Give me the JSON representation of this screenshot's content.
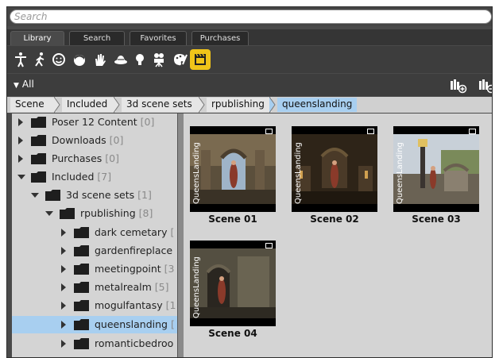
{
  "search": {
    "placeholder": "Search"
  },
  "tabs": [
    {
      "label": "Library",
      "active": true
    },
    {
      "label": "Search",
      "active": false
    },
    {
      "label": "Favorites",
      "active": false
    },
    {
      "label": "Purchases",
      "active": false
    }
  ],
  "toolbar_icons": [
    "figure-icon",
    "pose-icon",
    "expression-icon",
    "hair-icon",
    "hand-icon",
    "props-icon",
    "light-icon",
    "camera-icon",
    "materials-icon",
    "scene-icon"
  ],
  "filter": {
    "label": "All"
  },
  "breadcrumb": [
    "Scene",
    "Included",
    "3d scene sets",
    "rpublishing",
    "queenslanding"
  ],
  "tree": [
    {
      "label": "Poser 12 Content",
      "count": "[0]"
    },
    {
      "label": "Downloads",
      "count": "[0]"
    },
    {
      "label": "Purchases",
      "count": "[0]"
    },
    {
      "label": "Included",
      "count": "[7]"
    },
    {
      "label": "3d scene sets",
      "count": "[1]"
    },
    {
      "label": "rpublishing",
      "count": "[8]"
    },
    {
      "label": "dark cemetary",
      "count": "["
    },
    {
      "label": "gardenfireplace",
      "count": ""
    },
    {
      "label": "meetingpoint",
      "count": "[3"
    },
    {
      "label": "metalrealm",
      "count": "[5]"
    },
    {
      "label": "mogulfantasy",
      "count": "[1"
    },
    {
      "label": "queenslanding",
      "count": "["
    },
    {
      "label": "romanticbedroo",
      "count": ""
    }
  ],
  "thumbnails": [
    {
      "caption": "Scene 01",
      "watermark": "QueensLanding"
    },
    {
      "caption": "Scene 02",
      "watermark": "QueensLanding"
    },
    {
      "caption": "Scene 03",
      "watermark": "QueensLanding"
    },
    {
      "caption": "Scene 04",
      "watermark": "QueensLanding"
    }
  ],
  "colors": {
    "accent": "#f0c419",
    "selection": "#a8cff0",
    "panel": "#d4d4d4",
    "chrome": "#4a4a4a"
  }
}
